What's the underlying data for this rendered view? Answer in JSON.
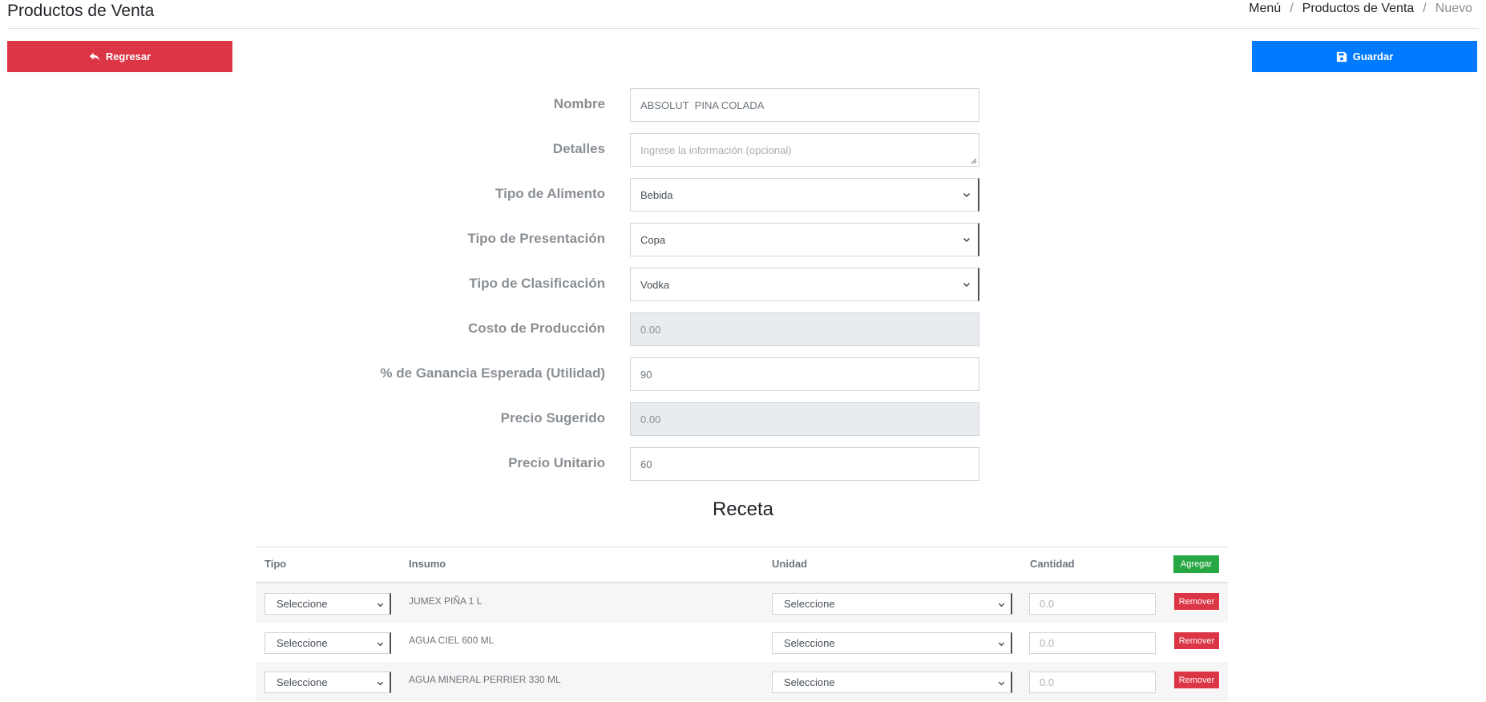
{
  "header": {
    "title": "Productos de Venta",
    "breadcrumb": [
      "Menú",
      "Productos de Venta",
      "Nuevo"
    ]
  },
  "toolbar": {
    "back_label": "Regresar",
    "save_label": "Guardar"
  },
  "form": {
    "nombre": {
      "label": "Nombre",
      "value": "ABSOLUT  PINA COLADA"
    },
    "detalles": {
      "label": "Detalles",
      "placeholder": "Ingrese la información (opcional)"
    },
    "tipo_alimento": {
      "label": "Tipo de Alimento",
      "value": "Bebida"
    },
    "tipo_presentacion": {
      "label": "Tipo de Presentación",
      "value": "Copa"
    },
    "tipo_clasificacion": {
      "label": "Tipo de Clasificación",
      "value": "Vodka"
    },
    "costo_produccion": {
      "label": "Costo de Producción",
      "value": "0.00"
    },
    "ganancia": {
      "label": "% de Ganancia Esperada (Utilidad)",
      "value": "90"
    },
    "precio_sugerido": {
      "label": "Precio Sugerido",
      "value": "0.00"
    },
    "precio_unitario": {
      "label": "Precio Unitario",
      "value": "60"
    }
  },
  "receta": {
    "title": "Receta",
    "columns": [
      "Tipo",
      "Insumo",
      "Unidad",
      "Cantidad"
    ],
    "add_label": "Agregar",
    "rows": [
      {
        "tipo": "Seleccione",
        "insumo": "JUMEX PIÑA 1 L",
        "unidad": "Seleccione",
        "cantidad_placeholder": "0.0",
        "remove_label": "Remover"
      },
      {
        "tipo": "Seleccione",
        "insumo": "AGUA CIEL 600 ML",
        "unidad": "Seleccione",
        "cantidad_placeholder": "0.0",
        "remove_label": "Remover"
      },
      {
        "tipo": "Seleccione",
        "insumo": "AGUA MINERAL PERRIER 330 ML",
        "unidad": "Seleccione",
        "cantidad_placeholder": "0.0",
        "remove_label": "Remover"
      }
    ]
  }
}
